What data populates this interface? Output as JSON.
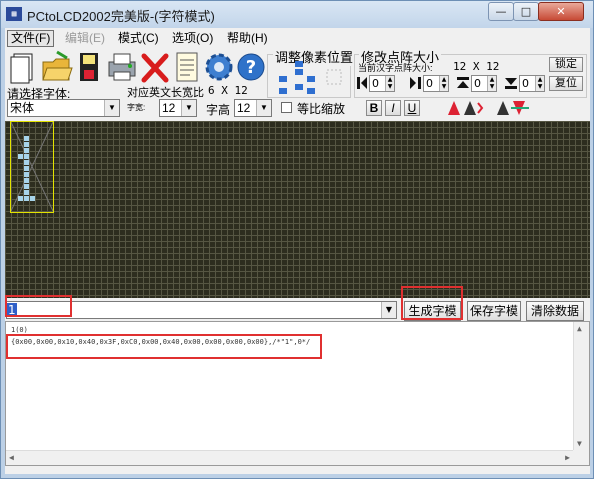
{
  "window": {
    "title": "PCtoLCD2002完美版-(字符模式)",
    "minimize": "—",
    "maximize": "□",
    "close": "✕"
  },
  "menu": [
    {
      "label": "文件(F)",
      "state": "active"
    },
    {
      "label": "编辑(E)",
      "state": "disabled"
    },
    {
      "label": "模式(C)",
      "state": "normal"
    },
    {
      "label": "选项(O)",
      "state": "normal"
    },
    {
      "label": "帮助(H)",
      "state": "normal"
    }
  ],
  "toolbar": {
    "icons": [
      "new-file-icon",
      "open-folder-icon",
      "save-disk-icon",
      "print-icon",
      "delete-x-icon",
      "notes-icon",
      "settings-gear-icon",
      "help-question-icon"
    ]
  },
  "font_panel": {
    "choose_font_label": "请选择字体:",
    "font_value": "宋体",
    "english_width_label": "对应英文长宽比",
    "english_width_value": "6 X 12",
    "width_label": "字宽:",
    "width_value": "12",
    "height_label": "字高",
    "height_value": "12",
    "proportional_label": "等比缩放",
    "bold": "B",
    "italic": "I",
    "underline": "U"
  },
  "pixel_panel": {
    "title": "调整像素位置"
  },
  "matrix_panel": {
    "title": "修改点阵大小",
    "current_label": "当前汉字点阵大小:",
    "current_value": "12 X 12",
    "lock_button": "锁定",
    "restore_button": "复位",
    "spin_values": [
      "0",
      "0",
      "0",
      "0"
    ]
  },
  "input": {
    "value": "1"
  },
  "buttons": {
    "generate": "生成字模",
    "save": "保存字模",
    "clear": "清除数据"
  },
  "output": {
    "line1": "1(0)",
    "line2": "{0x00,0x00,0x10,0x40,0x3F,0xC0,0x00,0x40,0x00,0x00,0x00,0x00},/*\"1\",0*/"
  },
  "colors": {
    "grid_bg": "#2d2d1f",
    "pixel_on": "#a7d4ea",
    "char_box": "#e3e300",
    "highlight": "#e03030"
  }
}
